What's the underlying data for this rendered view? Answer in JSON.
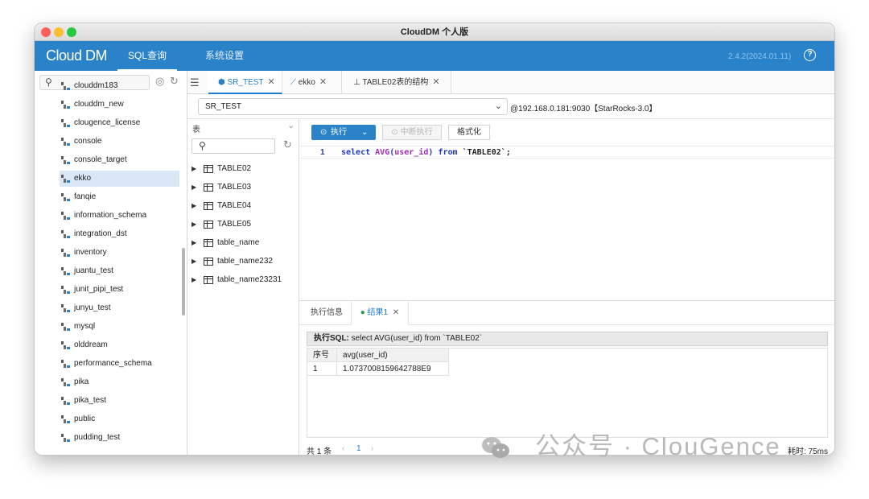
{
  "window": {
    "title": "CloudDM 个人版"
  },
  "appbar": {
    "logo": "Cloud DM",
    "nav_sql": "SQL查询",
    "nav_settings": "系统设置",
    "version": "2.4.2(2024.01.11)",
    "help": "?"
  },
  "sidebar": {
    "search_placeholder": "",
    "items": [
      "clouddm183",
      "clouddm_new",
      "clougence_license",
      "console",
      "console_target",
      "ekko",
      "fanqie",
      "information_schema",
      "integration_dst",
      "inventory",
      "juantu_test",
      "junit_pipi_test",
      "junyu_test",
      "mysql",
      "olddream",
      "performance_schema",
      "pika",
      "pika_test",
      "public",
      "pudding_test"
    ],
    "selected": "ekko"
  },
  "tabs": [
    {
      "label": "SR_TEST",
      "icon": "starrocks-icon",
      "active": true
    },
    {
      "label": "ekko",
      "icon": "mysql-icon",
      "active": false
    },
    {
      "label": "TABLE02表的结构",
      "icon": "structure-icon",
      "active": false
    }
  ],
  "db_selector": {
    "value": "SR_TEST",
    "connection": "@192.168.0.181:9030【StarRocks-3.0】"
  },
  "table_panel": {
    "type_label": "表",
    "tables": [
      "TABLE02",
      "TABLE03",
      "TABLE04",
      "TABLE05",
      "table_name",
      "table_name232",
      "table_name23231"
    ]
  },
  "toolbar": {
    "run": "执行",
    "stop": "中断执行",
    "format": "格式化"
  },
  "editor": {
    "line_no": "1",
    "tokens": {
      "select": "select",
      "avg": "AVG",
      "lp": "(",
      "col": "user_id",
      "rp": ")",
      "from": "from",
      "table": "`TABLE02`",
      "semi": ";"
    }
  },
  "results": {
    "tab_info": "执行信息",
    "tab_result": "结果1",
    "sql_label": "执行SQL:",
    "sql_text": "select AVG(user_id) from `TABLE02`",
    "columns": [
      "序号",
      "avg(user_id)"
    ],
    "rows": [
      [
        "1",
        "1.0737008159642788E9"
      ]
    ],
    "total": "共 1 条",
    "page": "1",
    "elapsed": "耗时: 75ms"
  },
  "watermark": {
    "text": "公众号 · ClouGence"
  },
  "colors": {
    "brand_blue": "#2a82c8",
    "active_tab": "#1e7fd0",
    "success": "#2a9d3f"
  }
}
